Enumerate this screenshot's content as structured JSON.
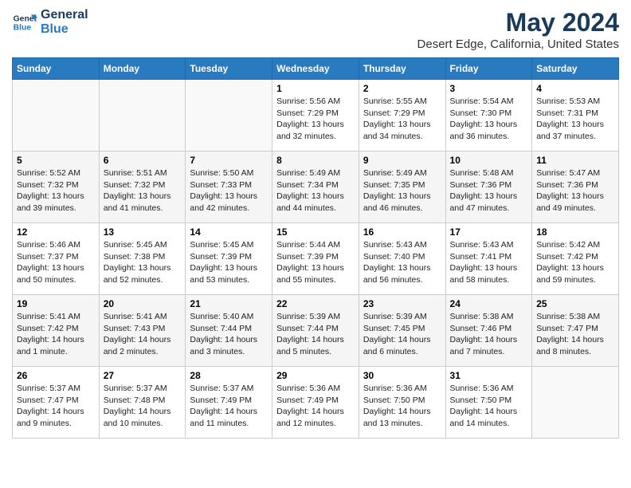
{
  "logo": {
    "line1": "General",
    "line2": "Blue"
  },
  "title": "May 2024",
  "subtitle": "Desert Edge, California, United States",
  "headers": [
    "Sunday",
    "Monday",
    "Tuesday",
    "Wednesday",
    "Thursday",
    "Friday",
    "Saturday"
  ],
  "weeks": [
    [
      {
        "day": "",
        "info": ""
      },
      {
        "day": "",
        "info": ""
      },
      {
        "day": "",
        "info": ""
      },
      {
        "day": "1",
        "info": "Sunrise: 5:56 AM\nSunset: 7:29 PM\nDaylight: 13 hours\nand 32 minutes."
      },
      {
        "day": "2",
        "info": "Sunrise: 5:55 AM\nSunset: 7:29 PM\nDaylight: 13 hours\nand 34 minutes."
      },
      {
        "day": "3",
        "info": "Sunrise: 5:54 AM\nSunset: 7:30 PM\nDaylight: 13 hours\nand 36 minutes."
      },
      {
        "day": "4",
        "info": "Sunrise: 5:53 AM\nSunset: 7:31 PM\nDaylight: 13 hours\nand 37 minutes."
      }
    ],
    [
      {
        "day": "5",
        "info": "Sunrise: 5:52 AM\nSunset: 7:32 PM\nDaylight: 13 hours\nand 39 minutes."
      },
      {
        "day": "6",
        "info": "Sunrise: 5:51 AM\nSunset: 7:32 PM\nDaylight: 13 hours\nand 41 minutes."
      },
      {
        "day": "7",
        "info": "Sunrise: 5:50 AM\nSunset: 7:33 PM\nDaylight: 13 hours\nand 42 minutes."
      },
      {
        "day": "8",
        "info": "Sunrise: 5:49 AM\nSunset: 7:34 PM\nDaylight: 13 hours\nand 44 minutes."
      },
      {
        "day": "9",
        "info": "Sunrise: 5:49 AM\nSunset: 7:35 PM\nDaylight: 13 hours\nand 46 minutes."
      },
      {
        "day": "10",
        "info": "Sunrise: 5:48 AM\nSunset: 7:36 PM\nDaylight: 13 hours\nand 47 minutes."
      },
      {
        "day": "11",
        "info": "Sunrise: 5:47 AM\nSunset: 7:36 PM\nDaylight: 13 hours\nand 49 minutes."
      }
    ],
    [
      {
        "day": "12",
        "info": "Sunrise: 5:46 AM\nSunset: 7:37 PM\nDaylight: 13 hours\nand 50 minutes."
      },
      {
        "day": "13",
        "info": "Sunrise: 5:45 AM\nSunset: 7:38 PM\nDaylight: 13 hours\nand 52 minutes."
      },
      {
        "day": "14",
        "info": "Sunrise: 5:45 AM\nSunset: 7:39 PM\nDaylight: 13 hours\nand 53 minutes."
      },
      {
        "day": "15",
        "info": "Sunrise: 5:44 AM\nSunset: 7:39 PM\nDaylight: 13 hours\nand 55 minutes."
      },
      {
        "day": "16",
        "info": "Sunrise: 5:43 AM\nSunset: 7:40 PM\nDaylight: 13 hours\nand 56 minutes."
      },
      {
        "day": "17",
        "info": "Sunrise: 5:43 AM\nSunset: 7:41 PM\nDaylight: 13 hours\nand 58 minutes."
      },
      {
        "day": "18",
        "info": "Sunrise: 5:42 AM\nSunset: 7:42 PM\nDaylight: 13 hours\nand 59 minutes."
      }
    ],
    [
      {
        "day": "19",
        "info": "Sunrise: 5:41 AM\nSunset: 7:42 PM\nDaylight: 14 hours\nand 1 minute."
      },
      {
        "day": "20",
        "info": "Sunrise: 5:41 AM\nSunset: 7:43 PM\nDaylight: 14 hours\nand 2 minutes."
      },
      {
        "day": "21",
        "info": "Sunrise: 5:40 AM\nSunset: 7:44 PM\nDaylight: 14 hours\nand 3 minutes."
      },
      {
        "day": "22",
        "info": "Sunrise: 5:39 AM\nSunset: 7:44 PM\nDaylight: 14 hours\nand 5 minutes."
      },
      {
        "day": "23",
        "info": "Sunrise: 5:39 AM\nSunset: 7:45 PM\nDaylight: 14 hours\nand 6 minutes."
      },
      {
        "day": "24",
        "info": "Sunrise: 5:38 AM\nSunset: 7:46 PM\nDaylight: 14 hours\nand 7 minutes."
      },
      {
        "day": "25",
        "info": "Sunrise: 5:38 AM\nSunset: 7:47 PM\nDaylight: 14 hours\nand 8 minutes."
      }
    ],
    [
      {
        "day": "26",
        "info": "Sunrise: 5:37 AM\nSunset: 7:47 PM\nDaylight: 14 hours\nand 9 minutes."
      },
      {
        "day": "27",
        "info": "Sunrise: 5:37 AM\nSunset: 7:48 PM\nDaylight: 14 hours\nand 10 minutes."
      },
      {
        "day": "28",
        "info": "Sunrise: 5:37 AM\nSunset: 7:49 PM\nDaylight: 14 hours\nand 11 minutes."
      },
      {
        "day": "29",
        "info": "Sunrise: 5:36 AM\nSunset: 7:49 PM\nDaylight: 14 hours\nand 12 minutes."
      },
      {
        "day": "30",
        "info": "Sunrise: 5:36 AM\nSunset: 7:50 PM\nDaylight: 14 hours\nand 13 minutes."
      },
      {
        "day": "31",
        "info": "Sunrise: 5:36 AM\nSunset: 7:50 PM\nDaylight: 14 hours\nand 14 minutes."
      },
      {
        "day": "",
        "info": ""
      }
    ]
  ]
}
